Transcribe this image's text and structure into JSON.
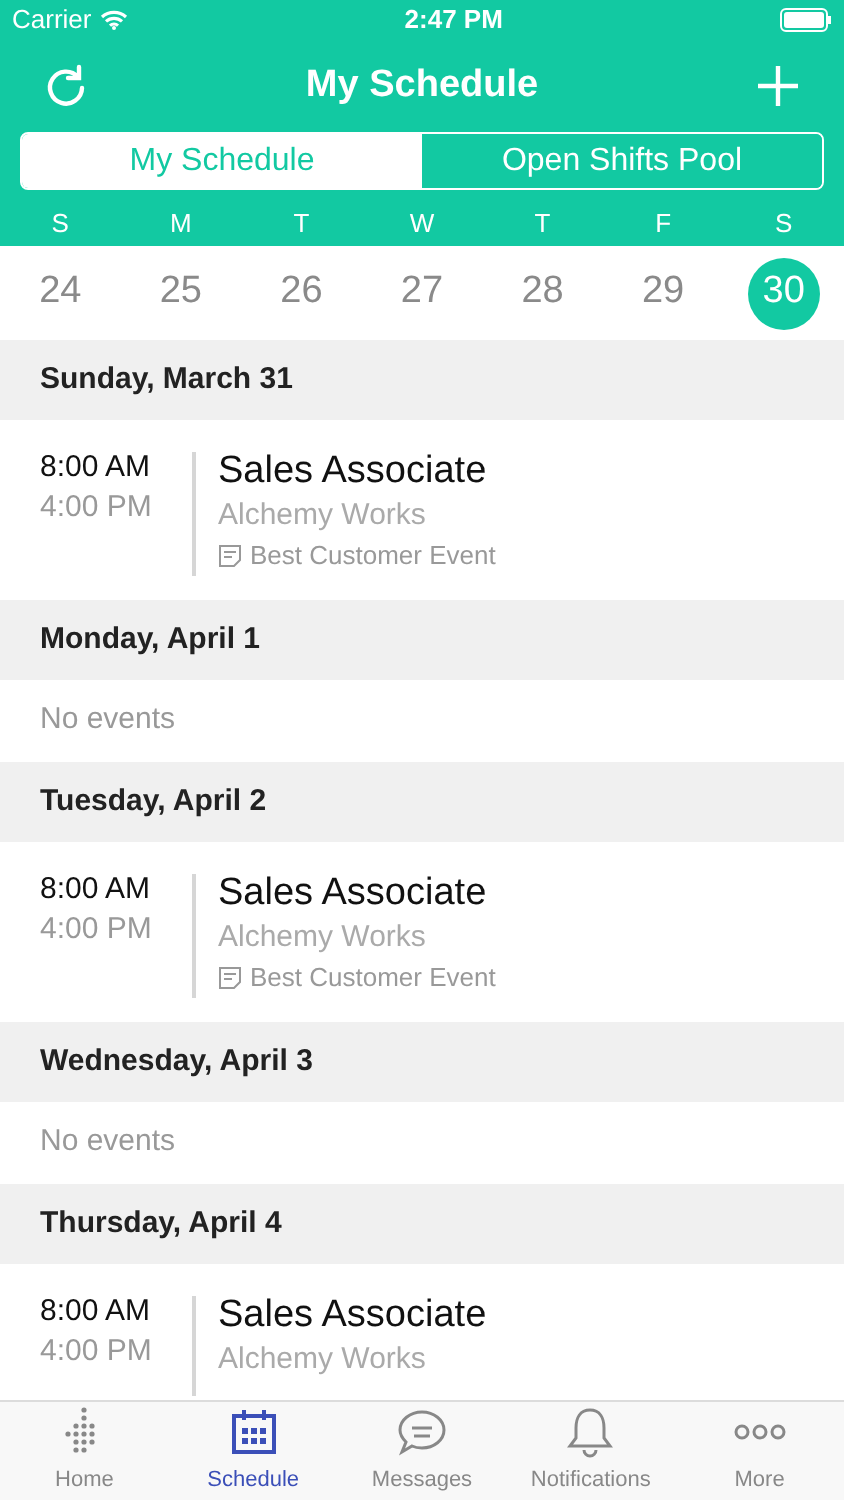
{
  "status_bar": {
    "carrier": "Carrier",
    "time": "2:47 PM"
  },
  "nav": {
    "title": "My Schedule"
  },
  "segments": [
    {
      "label": "My Schedule",
      "selected": true
    },
    {
      "label": "Open Shifts Pool",
      "selected": false
    }
  ],
  "week": [
    {
      "weekday": "S",
      "date": "24",
      "selected": false
    },
    {
      "weekday": "M",
      "date": "25",
      "selected": false
    },
    {
      "weekday": "T",
      "date": "26",
      "selected": false
    },
    {
      "weekday": "W",
      "date": "27",
      "selected": false
    },
    {
      "weekday": "T",
      "date": "28",
      "selected": false
    },
    {
      "weekday": "F",
      "date": "29",
      "selected": false
    },
    {
      "weekday": "S",
      "date": "30",
      "selected": true
    }
  ],
  "days": [
    {
      "heading": "Sunday, March 31",
      "events": [
        {
          "start": "8:00 AM",
          "end": "4:00 PM",
          "title": "Sales Associate",
          "location": "Alchemy Works",
          "note": "Best Customer Event"
        }
      ]
    },
    {
      "heading": "Monday, April 1",
      "empty_text": "No events"
    },
    {
      "heading": "Tuesday, April 2",
      "events": [
        {
          "start": "8:00 AM",
          "end": "4:00 PM",
          "title": "Sales Associate",
          "location": "Alchemy Works",
          "note": "Best Customer Event"
        }
      ]
    },
    {
      "heading": "Wednesday, April 3",
      "empty_text": "No events"
    },
    {
      "heading": "Thursday, April 4",
      "events": [
        {
          "start": "8:00 AM",
          "end": "4:00 PM",
          "title": "Sales Associate",
          "location": "Alchemy Works"
        }
      ]
    }
  ],
  "tab_bar": [
    {
      "kind": "home",
      "label": "Home",
      "selected": false
    },
    {
      "kind": "schedule",
      "label": "Schedule",
      "selected": true
    },
    {
      "kind": "messages",
      "label": "Messages",
      "selected": false
    },
    {
      "kind": "notifications",
      "label": "Notifications",
      "selected": false
    },
    {
      "kind": "more",
      "label": "More",
      "selected": false
    }
  ]
}
